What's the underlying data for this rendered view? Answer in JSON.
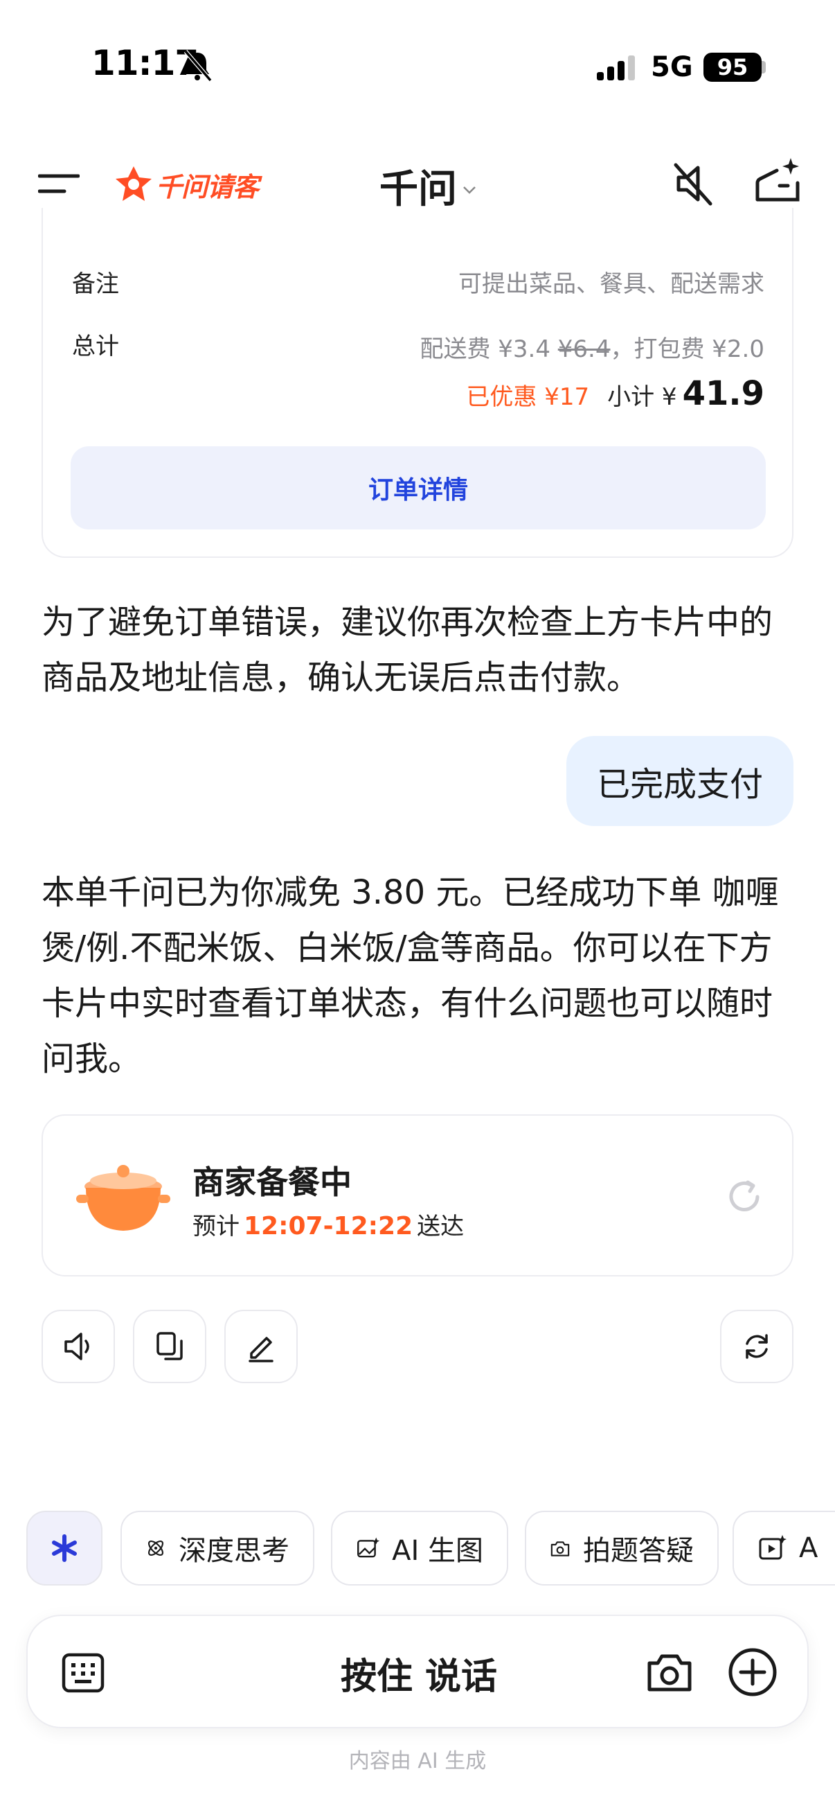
{
  "status_bar": {
    "time": "11:17",
    "network": "5G",
    "battery": "95"
  },
  "header": {
    "logo_text": "千问请客",
    "title": "千问"
  },
  "order_card": {
    "remark_label": "备注",
    "remark_placeholder": "可提出菜品、餐具、配送需求",
    "total_label": "总计",
    "fees_prefix": "配送费 ¥3.4 ",
    "fees_original": "¥6.4",
    "fees_suffix": "，打包费 ¥2.0",
    "discount": "已优惠 ¥17",
    "subtotal_label": "小计 ¥",
    "subtotal_amount": "41.9",
    "detail_button": "订单详情"
  },
  "messages": {
    "assistant_1": "为了避免订单错误，建议你再次检查上方卡片中的商品及地址信息，确认无误后点击付款。",
    "user_1": "已完成支付",
    "assistant_2": "本单千问已为你减免 3.80 元。已经成功下单 咖喱煲/例.不配米饭、白米饭/盒等商品。你可以在下方卡片中实时查看订单状态，有什么问题也可以随时问我。"
  },
  "status_card": {
    "title": "商家备餐中",
    "eta_prefix": "预计",
    "eta_time": "12:07-12:22",
    "eta_suffix": "送达"
  },
  "chips": [
    {
      "label": "深度思考",
      "icon": "atom-icon"
    },
    {
      "label": "AI 生图",
      "icon": "image-sparkle-icon"
    },
    {
      "label": "拍题答疑",
      "icon": "camera-question-icon"
    },
    {
      "label": "A",
      "icon": "video-sparkle-icon"
    }
  ],
  "input_bar": {
    "hold_to_talk": "按住 说话"
  },
  "footer_note": "内容由 AI 生成",
  "colors": {
    "accent_orange": "#ff5a1f",
    "link_blue": "#2244dd",
    "user_bubble": "#e8f2ff"
  }
}
